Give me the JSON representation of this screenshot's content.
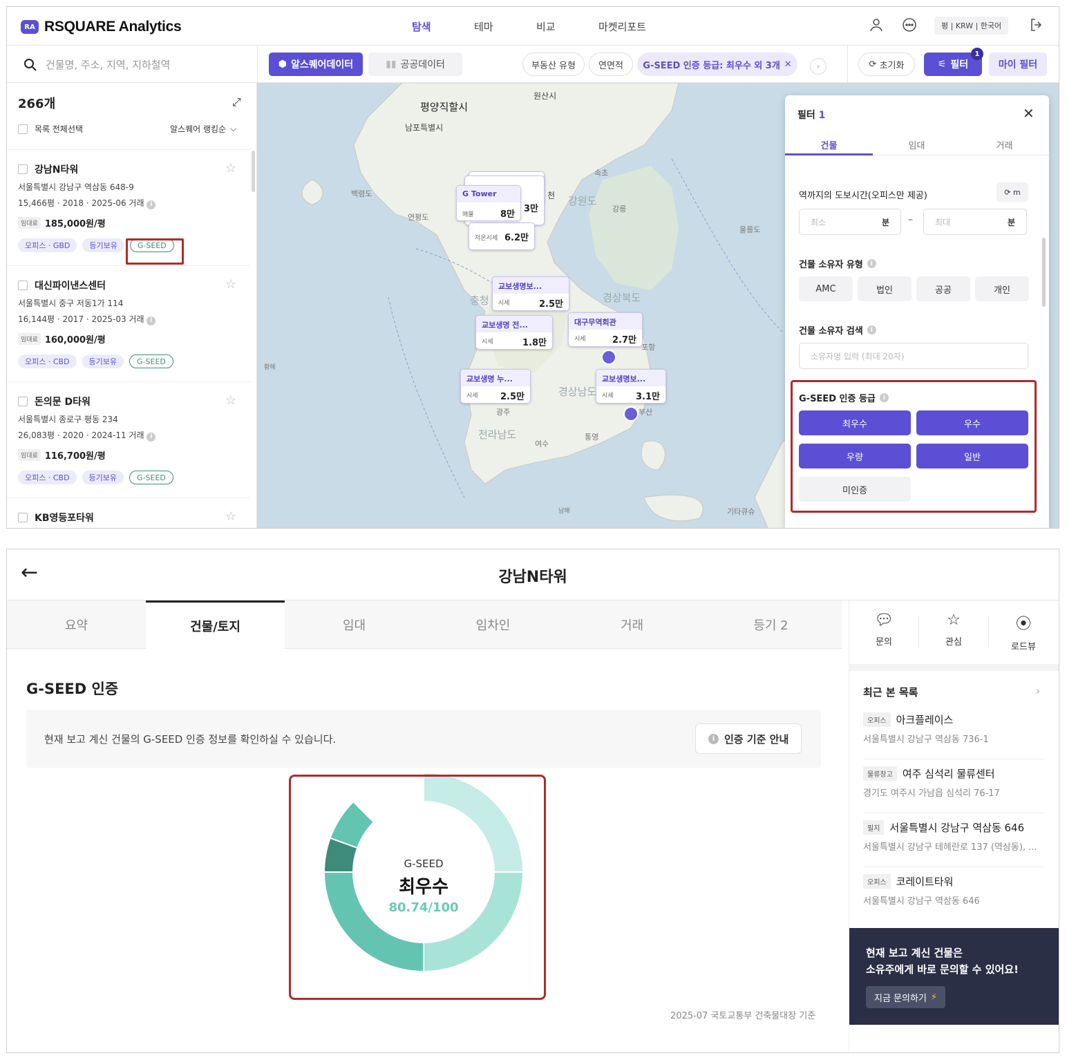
{
  "top": {
    "logo_mark": "RA",
    "logo_text": "RSQUARE Analytics",
    "nav": [
      "탐색",
      "테마",
      "비교",
      "마켓리포트"
    ],
    "unit_pill": "평 | KRW | 한국어"
  },
  "filterbar": {
    "search_placeholder": "건물명, 주소, 지역, 지하철역",
    "source_rsquare": "알스퀘어데이터",
    "source_public": "공공데이터",
    "chips": [
      "부동산 유형",
      "연면적"
    ],
    "selected_chip": "G-SEED 인증 등급: 최우수 외 3개",
    "reset": "초기화",
    "filter": "필터",
    "filter_badge": "1",
    "my_filter": "마이 필터"
  },
  "list": {
    "count": "266개",
    "select_all": "목록 전체선택",
    "sort": "알스퀘어 랭킹순",
    "rent_tag": "임대료",
    "items": [
      {
        "name": "강남N타워",
        "address": "서울특별시 강남구 역삼동 648-9",
        "meta": "15,466평 · 2018 · 2025-06 거래",
        "rent": "185,000원/평",
        "tag1": "오피스 · GBD",
        "tag2": "등기보유",
        "tag3": "G-SEED"
      },
      {
        "name": "대신파이낸스센터",
        "address": "서울특별시 중구 저동1가 114",
        "meta": "16,144평 · 2017 · 2025-03 거래",
        "rent": "160,000원/평",
        "tag1": "오피스 · CBD",
        "tag2": "등기보유",
        "tag3": "G-SEED"
      },
      {
        "name": "돈의문 D타워",
        "address": "서울특별시 종로구 평동 234",
        "meta": "26,083평 · 2020 · 2024-11 거래",
        "rent": "116,700원/평",
        "tag1": "오피스 · CBD",
        "tag2": "등기보유",
        "tag3": "G-SEED"
      },
      {
        "name": "KB영등포타워"
      }
    ]
  },
  "map": {
    "labels": [
      "원산시",
      "평양직할시",
      "남포특별시",
      "백령도",
      "연평도",
      "강원도",
      "속초",
      "강릉",
      "울릉도",
      "충청",
      "경상북도",
      "포항",
      "광주",
      "경상남도",
      "전라남도",
      "여수",
      "통영",
      "부산",
      "기타큐슈",
      "남해",
      "황해"
    ],
    "callouts": [
      {
        "name": "G Tower",
        "key": "매물",
        "value": "8만"
      },
      {
        "name": "",
        "key": "저온시세",
        "value": "6.2만"
      },
      {
        "name": "교보생명보...",
        "key": "시세",
        "value": "2.5만"
      },
      {
        "name": "교보생명 전...",
        "key": "시세",
        "value": "1.8만"
      },
      {
        "name": "대구무역회관",
        "key": "시세",
        "value": "2.7만"
      },
      {
        "name": "교보생명 누...",
        "key": "시세",
        "value": "2.5만"
      },
      {
        "name": "교보생명보...",
        "key": "시세",
        "value": "3.1만"
      }
    ],
    "stack_fragments": [
      "3만",
      "천"
    ]
  },
  "filter_panel": {
    "title": "필터",
    "count": "1",
    "tabs": [
      "건물",
      "임대",
      "거래"
    ],
    "walk_title": "역까지의 도보시간(오피스만 제공)",
    "walk_unit_btn": "m",
    "min_ph": "최소",
    "max_ph": "최대",
    "min_unit": "분",
    "max_unit": "분",
    "range_sep": "–",
    "owner_type_title": "건물 소유자 유형",
    "owner_types": [
      "AMC",
      "법인",
      "공공",
      "개인"
    ],
    "owner_search_title": "건물 소유자 검색",
    "owner_search_ph": "소유자명 입력 (최대 20자)",
    "gseed_title": "G-SEED 인증 등급",
    "gseed_options": [
      "최우수",
      "우수",
      "우량",
      "일반"
    ],
    "gseed_none": "미인증"
  },
  "detail": {
    "title": "강남N타워",
    "tabs": [
      "요약",
      "건물/토지",
      "임대",
      "임차인",
      "거래",
      "등기 2"
    ],
    "actions": [
      "문의",
      "관심",
      "로드뷰"
    ],
    "section_title": "G-SEED 인증",
    "note": "현재 보고 계신 건물의 G-SEED 인증 정보를 확인하실 수 있습니다.",
    "guide_button": "인증 기준 안내",
    "donut_label": "G-SEED",
    "grade": "최우수",
    "score": "80.74/100",
    "source": "2025-07 국토교통부 건축물대장 기준"
  },
  "chart_data": {
    "type": "pie",
    "categories": [
      "최우수",
      "우수",
      "우량",
      "일반"
    ],
    "values": [
      25,
      25,
      25,
      25
    ],
    "highlight_category": "최우수",
    "score": 80.74,
    "max_score": 100,
    "title": "G-SEED"
  },
  "recent": {
    "title": "최근 본 목록",
    "items": [
      {
        "tag": "오피스",
        "name": "아크플레이스",
        "address": "서울특별시 강남구 역삼동 736-1"
      },
      {
        "tag": "물류창고",
        "name": "여주 심석리 물류센터",
        "address": "경기도 여주시 가남읍 심석리 76-17"
      },
      {
        "tag": "필지",
        "name": "서울특별시 강남구 역삼동 646",
        "address": "서울특별시 강남구 테헤란로 137 (역삼동), ..."
      },
      {
        "tag": "오피스",
        "name": "코레이트타워",
        "address": "서울특별시 강남구 역삼동 646"
      }
    ]
  },
  "promo": {
    "line1": "현재 보고 계신 건물은",
    "line2": "소유주에게 바로 문의할 수 있어요!",
    "button": "지금 문의하기"
  },
  "colors": {
    "accent": "#5b4fd6",
    "highlight_box": "#b22a2a",
    "donut_dark": "#3e8b7b",
    "donut_mid": "#63c4b2",
    "donut_light": "#a8e3d8",
    "donut_pale": "#c5ece6"
  }
}
